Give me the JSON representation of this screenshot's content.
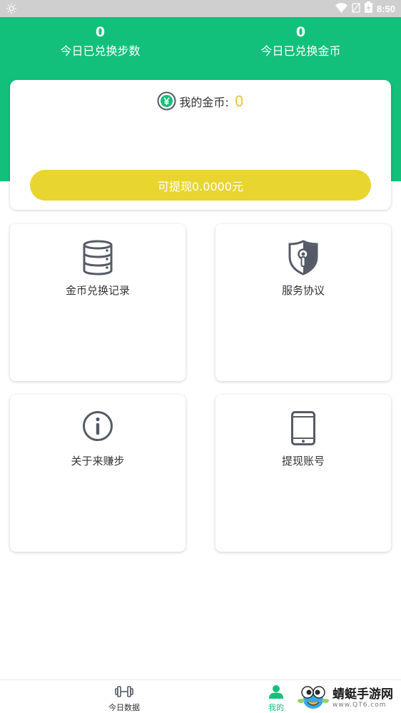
{
  "status_bar": {
    "time": "8:50"
  },
  "stats": {
    "steps": {
      "value": "0",
      "label": "今日已兑换步数"
    },
    "coins": {
      "value": "0",
      "label": "今日已兑换金币"
    }
  },
  "coin_card": {
    "label": "我的金币:",
    "value": "0",
    "withdraw_label": "可提现0.0000元"
  },
  "menu": {
    "exchange_record": "金币兑换记录",
    "service_agreement": "服务协议",
    "about": "关于来赚步",
    "withdraw_account": "提现账号"
  },
  "bottom_nav": {
    "today": "今日数据",
    "mine": "我的"
  },
  "watermark": {
    "title": "蜻蜓手游网",
    "url": "www.QT6.com"
  },
  "colors": {
    "primary_green": "#12c07b",
    "withdraw_yellow": "#e8d530",
    "coin_gold": "#f0c23b"
  }
}
